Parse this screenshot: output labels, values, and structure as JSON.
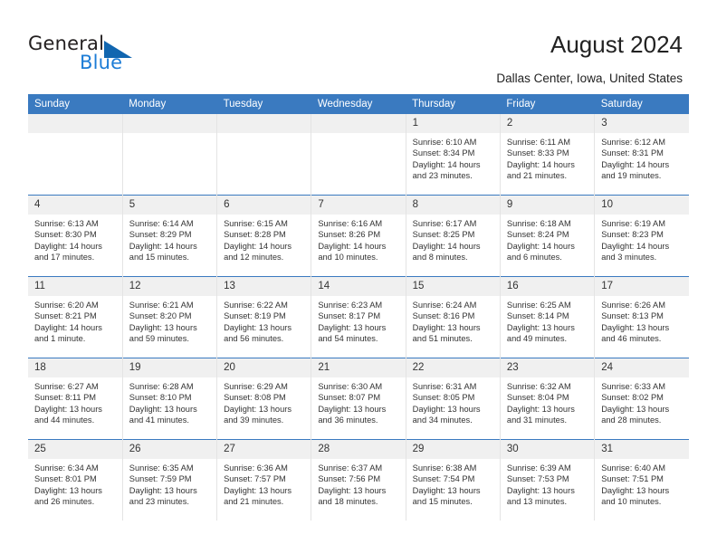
{
  "brand": {
    "name_top": "General",
    "name_bottom": "Blue",
    "triangle_color": "#1166b0",
    "blue_color": "#1c7cd6"
  },
  "header": {
    "title": "August 2024",
    "subtitle": "Dallas Center, Iowa, United States",
    "header_bg": "#3a7ac0",
    "daynum_bg": "#f0f0f0"
  },
  "weekday_headers": [
    "Sunday",
    "Monday",
    "Tuesday",
    "Wednesday",
    "Thursday",
    "Friday",
    "Saturday"
  ],
  "labels": {
    "sunrise_prefix": "Sunrise:",
    "sunset_prefix": "Sunset:",
    "daylight_prefix": "Daylight:"
  },
  "weeks": [
    [
      {
        "day": "",
        "line1": "",
        "line2": "",
        "line3": "",
        "line4": ""
      },
      {
        "day": "",
        "line1": "",
        "line2": "",
        "line3": "",
        "line4": ""
      },
      {
        "day": "",
        "line1": "",
        "line2": "",
        "line3": "",
        "line4": ""
      },
      {
        "day": "",
        "line1": "",
        "line2": "",
        "line3": "",
        "line4": ""
      },
      {
        "day": "1",
        "line1": "Sunrise: 6:10 AM",
        "line2": "Sunset: 8:34 PM",
        "line3": "Daylight: 14 hours",
        "line4": "and 23 minutes."
      },
      {
        "day": "2",
        "line1": "Sunrise: 6:11 AM",
        "line2": "Sunset: 8:33 PM",
        "line3": "Daylight: 14 hours",
        "line4": "and 21 minutes."
      },
      {
        "day": "3",
        "line1": "Sunrise: 6:12 AM",
        "line2": "Sunset: 8:31 PM",
        "line3": "Daylight: 14 hours",
        "line4": "and 19 minutes."
      }
    ],
    [
      {
        "day": "4",
        "line1": "Sunrise: 6:13 AM",
        "line2": "Sunset: 8:30 PM",
        "line3": "Daylight: 14 hours",
        "line4": "and 17 minutes."
      },
      {
        "day": "5",
        "line1": "Sunrise: 6:14 AM",
        "line2": "Sunset: 8:29 PM",
        "line3": "Daylight: 14 hours",
        "line4": "and 15 minutes."
      },
      {
        "day": "6",
        "line1": "Sunrise: 6:15 AM",
        "line2": "Sunset: 8:28 PM",
        "line3": "Daylight: 14 hours",
        "line4": "and 12 minutes."
      },
      {
        "day": "7",
        "line1": "Sunrise: 6:16 AM",
        "line2": "Sunset: 8:26 PM",
        "line3": "Daylight: 14 hours",
        "line4": "and 10 minutes."
      },
      {
        "day": "8",
        "line1": "Sunrise: 6:17 AM",
        "line2": "Sunset: 8:25 PM",
        "line3": "Daylight: 14 hours",
        "line4": "and 8 minutes."
      },
      {
        "day": "9",
        "line1": "Sunrise: 6:18 AM",
        "line2": "Sunset: 8:24 PM",
        "line3": "Daylight: 14 hours",
        "line4": "and 6 minutes."
      },
      {
        "day": "10",
        "line1": "Sunrise: 6:19 AM",
        "line2": "Sunset: 8:23 PM",
        "line3": "Daylight: 14 hours",
        "line4": "and 3 minutes."
      }
    ],
    [
      {
        "day": "11",
        "line1": "Sunrise: 6:20 AM",
        "line2": "Sunset: 8:21 PM",
        "line3": "Daylight: 14 hours",
        "line4": "and 1 minute."
      },
      {
        "day": "12",
        "line1": "Sunrise: 6:21 AM",
        "line2": "Sunset: 8:20 PM",
        "line3": "Daylight: 13 hours",
        "line4": "and 59 minutes."
      },
      {
        "day": "13",
        "line1": "Sunrise: 6:22 AM",
        "line2": "Sunset: 8:19 PM",
        "line3": "Daylight: 13 hours",
        "line4": "and 56 minutes."
      },
      {
        "day": "14",
        "line1": "Sunrise: 6:23 AM",
        "line2": "Sunset: 8:17 PM",
        "line3": "Daylight: 13 hours",
        "line4": "and 54 minutes."
      },
      {
        "day": "15",
        "line1": "Sunrise: 6:24 AM",
        "line2": "Sunset: 8:16 PM",
        "line3": "Daylight: 13 hours",
        "line4": "and 51 minutes."
      },
      {
        "day": "16",
        "line1": "Sunrise: 6:25 AM",
        "line2": "Sunset: 8:14 PM",
        "line3": "Daylight: 13 hours",
        "line4": "and 49 minutes."
      },
      {
        "day": "17",
        "line1": "Sunrise: 6:26 AM",
        "line2": "Sunset: 8:13 PM",
        "line3": "Daylight: 13 hours",
        "line4": "and 46 minutes."
      }
    ],
    [
      {
        "day": "18",
        "line1": "Sunrise: 6:27 AM",
        "line2": "Sunset: 8:11 PM",
        "line3": "Daylight: 13 hours",
        "line4": "and 44 minutes."
      },
      {
        "day": "19",
        "line1": "Sunrise: 6:28 AM",
        "line2": "Sunset: 8:10 PM",
        "line3": "Daylight: 13 hours",
        "line4": "and 41 minutes."
      },
      {
        "day": "20",
        "line1": "Sunrise: 6:29 AM",
        "line2": "Sunset: 8:08 PM",
        "line3": "Daylight: 13 hours",
        "line4": "and 39 minutes."
      },
      {
        "day": "21",
        "line1": "Sunrise: 6:30 AM",
        "line2": "Sunset: 8:07 PM",
        "line3": "Daylight: 13 hours",
        "line4": "and 36 minutes."
      },
      {
        "day": "22",
        "line1": "Sunrise: 6:31 AM",
        "line2": "Sunset: 8:05 PM",
        "line3": "Daylight: 13 hours",
        "line4": "and 34 minutes."
      },
      {
        "day": "23",
        "line1": "Sunrise: 6:32 AM",
        "line2": "Sunset: 8:04 PM",
        "line3": "Daylight: 13 hours",
        "line4": "and 31 minutes."
      },
      {
        "day": "24",
        "line1": "Sunrise: 6:33 AM",
        "line2": "Sunset: 8:02 PM",
        "line3": "Daylight: 13 hours",
        "line4": "and 28 minutes."
      }
    ],
    [
      {
        "day": "25",
        "line1": "Sunrise: 6:34 AM",
        "line2": "Sunset: 8:01 PM",
        "line3": "Daylight: 13 hours",
        "line4": "and 26 minutes."
      },
      {
        "day": "26",
        "line1": "Sunrise: 6:35 AM",
        "line2": "Sunset: 7:59 PM",
        "line3": "Daylight: 13 hours",
        "line4": "and 23 minutes."
      },
      {
        "day": "27",
        "line1": "Sunrise: 6:36 AM",
        "line2": "Sunset: 7:57 PM",
        "line3": "Daylight: 13 hours",
        "line4": "and 21 minutes."
      },
      {
        "day": "28",
        "line1": "Sunrise: 6:37 AM",
        "line2": "Sunset: 7:56 PM",
        "line3": "Daylight: 13 hours",
        "line4": "and 18 minutes."
      },
      {
        "day": "29",
        "line1": "Sunrise: 6:38 AM",
        "line2": "Sunset: 7:54 PM",
        "line3": "Daylight: 13 hours",
        "line4": "and 15 minutes."
      },
      {
        "day": "30",
        "line1": "Sunrise: 6:39 AM",
        "line2": "Sunset: 7:53 PM",
        "line3": "Daylight: 13 hours",
        "line4": "and 13 minutes."
      },
      {
        "day": "31",
        "line1": "Sunrise: 6:40 AM",
        "line2": "Sunset: 7:51 PM",
        "line3": "Daylight: 13 hours",
        "line4": "and 10 minutes."
      }
    ]
  ]
}
